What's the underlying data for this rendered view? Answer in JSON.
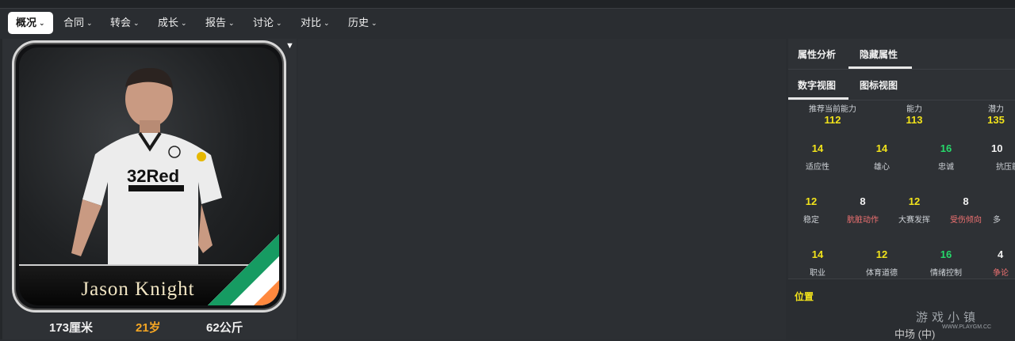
{
  "nav": {
    "tabs": [
      {
        "label": "概况"
      },
      {
        "label": "合同"
      },
      {
        "label": "转会"
      },
      {
        "label": "成长"
      },
      {
        "label": "报告"
      },
      {
        "label": "讨论"
      },
      {
        "label": "对比"
      },
      {
        "label": "历史"
      }
    ],
    "active_tab": "概况"
  },
  "player": {
    "name": "Jason Knight",
    "height": "173厘米",
    "age": "21岁",
    "weight": "62公斤",
    "shirt_sponsor": "32Red"
  },
  "right_panel": {
    "tabs": [
      "属性分析",
      "隐藏属性"
    ],
    "view_tabs": [
      "数字视图",
      "图标视图"
    ],
    "summary": [
      {
        "label": "推荐当前能力",
        "value": "112"
      },
      {
        "label": "能力",
        "value": "113"
      },
      {
        "label": "潜力",
        "value": "135"
      }
    ],
    "row1": [
      {
        "value": "14",
        "label": "适应性",
        "color": "yellow"
      },
      {
        "value": "14",
        "label": "雄心",
        "color": "yellow"
      },
      {
        "value": "16",
        "label": "忠诚",
        "color": "green"
      },
      {
        "value": "10",
        "label": "抗压能",
        "color": "white"
      }
    ],
    "row2": [
      {
        "value": "12",
        "label": "稳定",
        "color": "yellow"
      },
      {
        "value": "8",
        "label": "肮脏动作",
        "color": "white",
        "label_color": "red"
      },
      {
        "value": "12",
        "label": "大赛发挥",
        "color": "yellow"
      },
      {
        "value": "8",
        "label": "受伤倾向",
        "color": "white",
        "label_color": "red"
      },
      {
        "value": "",
        "label": "多",
        "color": "white"
      }
    ],
    "row3": [
      {
        "value": "14",
        "label": "职业",
        "color": "yellow"
      },
      {
        "value": "12",
        "label": "体育道德",
        "color": "yellow"
      },
      {
        "value": "16",
        "label": "情绪控制",
        "color": "green"
      },
      {
        "value": "4",
        "label": "争论",
        "color": "white",
        "label_color": "red"
      }
    ],
    "position_title": "位置",
    "position_value": "中场 (中)"
  },
  "watermark": {
    "text": "游戏小镇",
    "sub": "WWW.PLAYGM.CC"
  },
  "colors": {
    "accent_yellow": "#f2e31b",
    "accent_green": "#26d96a",
    "age_orange": "#f5a623"
  }
}
